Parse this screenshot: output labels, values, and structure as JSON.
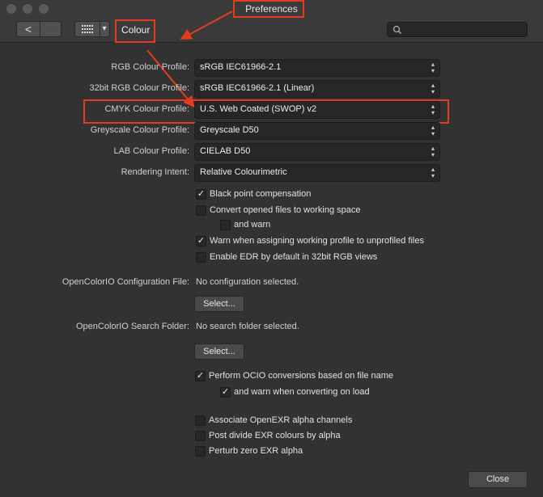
{
  "window": {
    "title": "Preferences"
  },
  "toolbar": {
    "active_tab": "Colour",
    "back_glyph": "<",
    "grid_icon": "grid-icon",
    "menu_arrow": "▾",
    "search_placeholder": ""
  },
  "colour": {
    "rgb_label": "RGB Colour Profile:",
    "rgb_value": "sRGB IEC61966-2.1",
    "rgb32_label": "32bit RGB Colour Profile:",
    "rgb32_value": "sRGB IEC61966-2.1 (Linear)",
    "cmyk_label": "CMYK Colour Profile:",
    "cmyk_value": "U.S. Web Coated (SWOP) v2",
    "grey_label": "Greyscale Colour Profile:",
    "grey_value": "Greyscale D50",
    "lab_label": "LAB Colour Profile:",
    "lab_value": "CIELAB D50",
    "intent_label": "Rendering Intent:",
    "intent_value": "Relative Colourimetric",
    "checks": [
      {
        "label": "Black point compensation",
        "checked": true
      },
      {
        "label": "Convert opened files to working space",
        "checked": false
      },
      {
        "label": "and warn",
        "checked": false
      },
      {
        "label": "Warn when assigning working profile to unprofiled files",
        "checked": true
      },
      {
        "label": "Enable EDR by default in 32bit RGB views",
        "checked": false
      }
    ],
    "ocio_config_label": "OpenColorIO Configuration File:",
    "ocio_config_value": "No configuration selected.",
    "select_label": "Select...",
    "ocio_search_label": "OpenColorIO Search Folder:",
    "ocio_search_value": "No search folder selected.",
    "ocio_checks": [
      {
        "label": "Perform OCIO conversions based on file name",
        "checked": true
      },
      {
        "label": "and warn when converting on load",
        "checked": true
      }
    ],
    "exr_checks": [
      {
        "label": "Associate OpenEXR alpha channels",
        "checked": false
      },
      {
        "label": "Post divide EXR colours by alpha",
        "checked": false
      },
      {
        "label": "Perturb zero EXR alpha",
        "checked": false
      }
    ],
    "close_label": "Close"
  },
  "glyphs": {
    "checkmark": "✓",
    "stepper_up": "▴",
    "stepper_down": "▾"
  },
  "colors": {
    "annotation": "#e53c1e",
    "window_bg": "#323232",
    "field_bg": "#262626"
  }
}
